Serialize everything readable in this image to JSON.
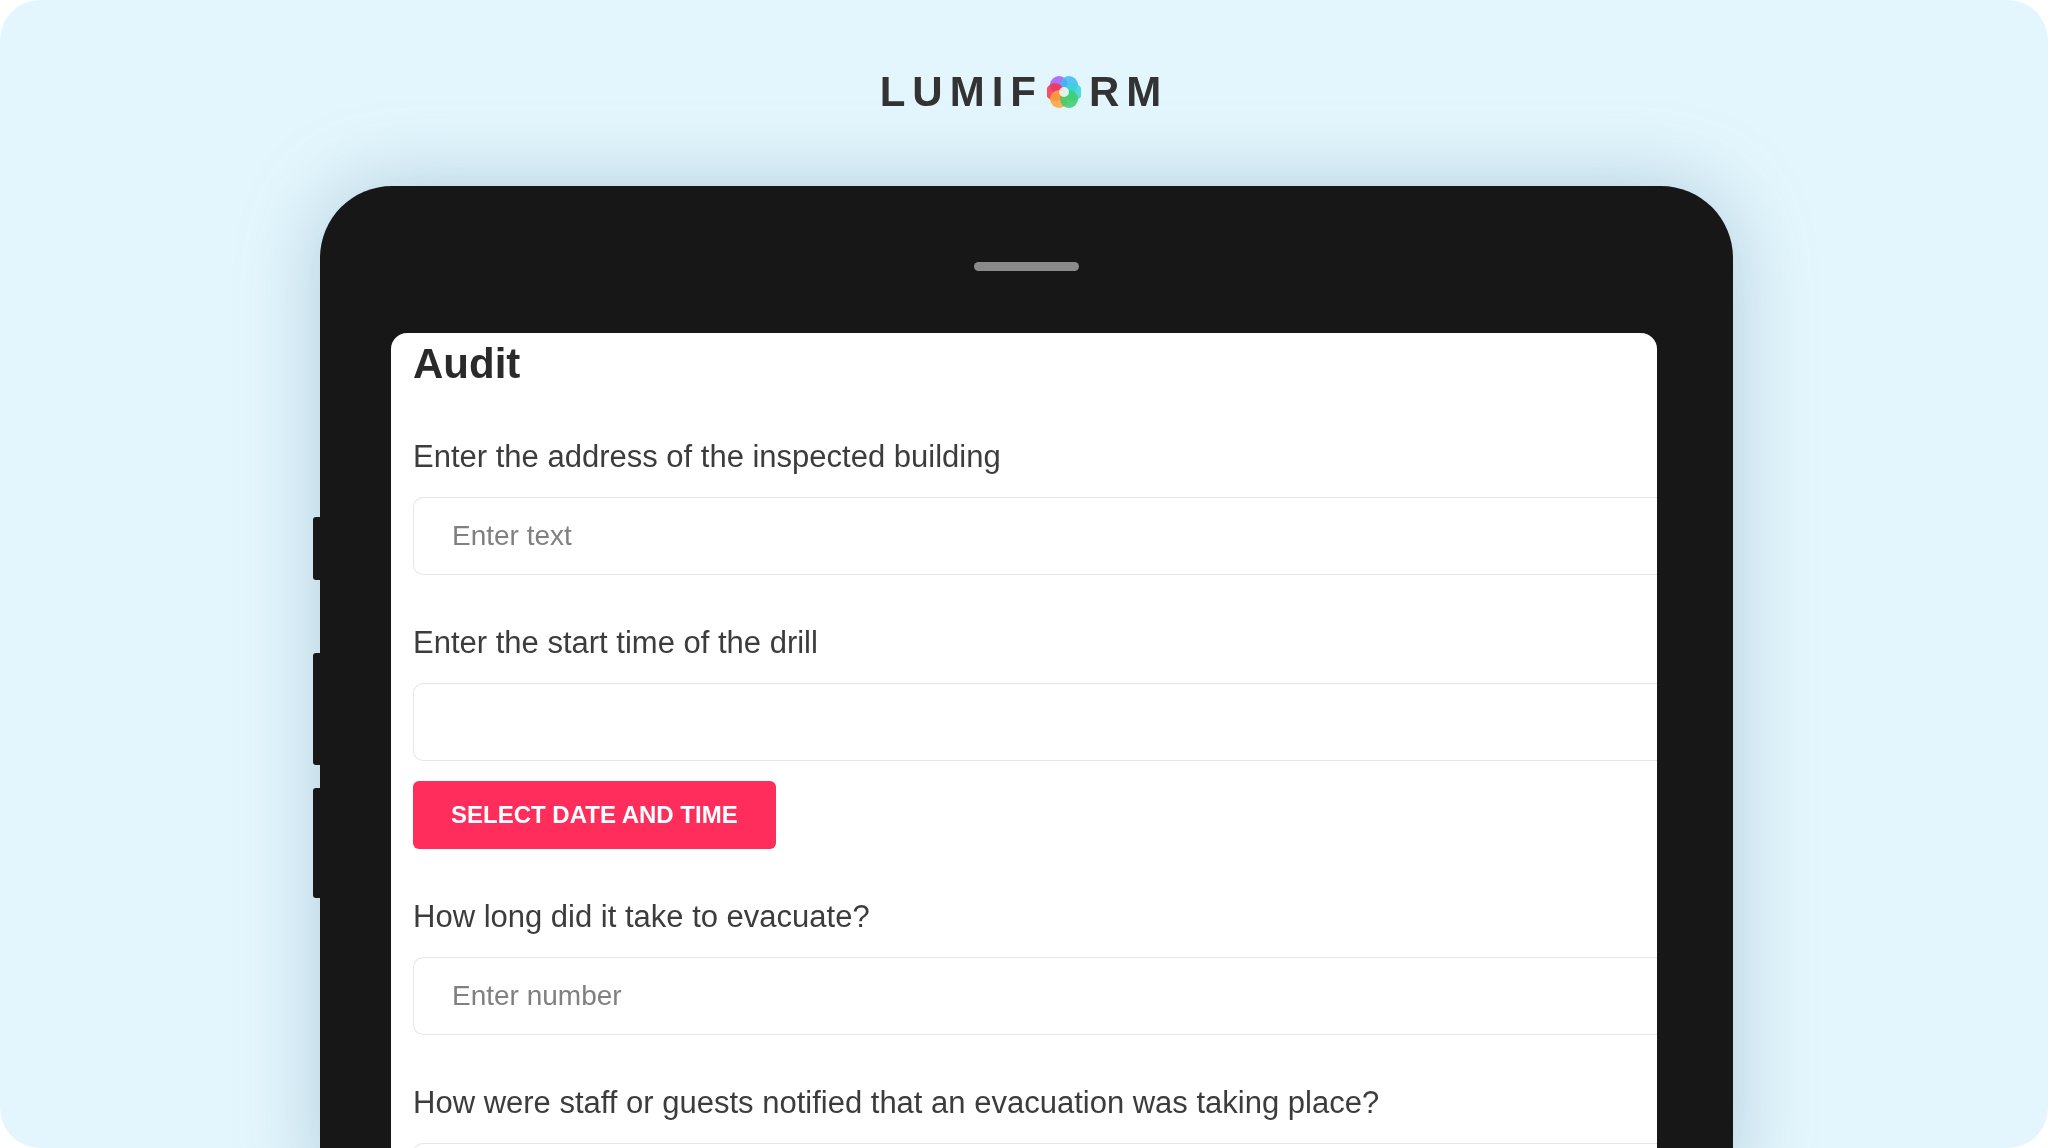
{
  "logo": {
    "before": "LUMIF",
    "after": "RM"
  },
  "form": {
    "title": "Audit",
    "questions": [
      {
        "kind": "text",
        "label": "Enter the address of the inspected building",
        "placeholder": "Enter text"
      },
      {
        "kind": "datetime",
        "label": "Enter the start time of the drill",
        "button": "SELECT DATE AND TIME"
      },
      {
        "kind": "text",
        "label": "How long did it take to evacuate?",
        "placeholder": "Enter number"
      },
      {
        "kind": "text",
        "label": "How were staff or guests notified that an evacuation was taking place?"
      }
    ]
  }
}
